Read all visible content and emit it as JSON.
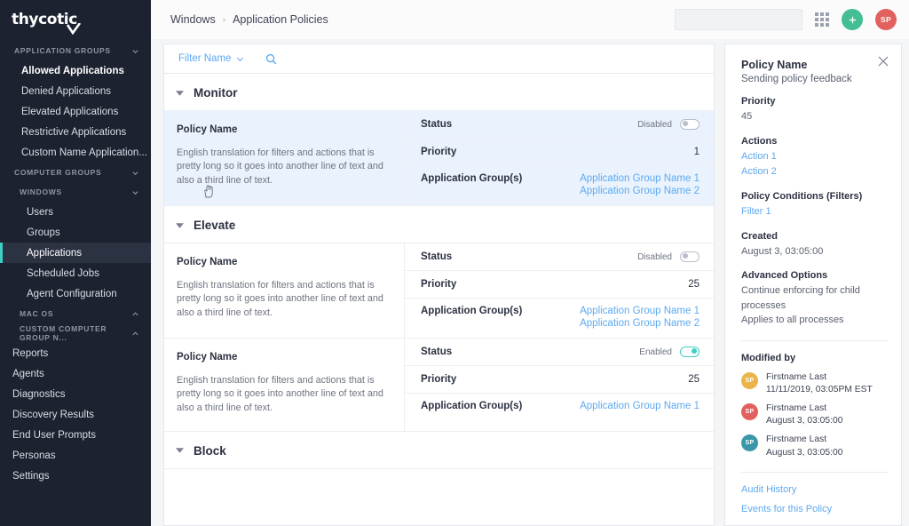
{
  "brand": {
    "logo_text": "thycotic",
    "accent": "#3ecfc4"
  },
  "sidebar": {
    "groups": [
      {
        "label": "APPLICATION GROUPS",
        "icon": "chevron-down-icon",
        "expanded": true
      },
      {
        "label": "COMPUTER GROUPS",
        "icon": "chevron-down-icon",
        "expanded": true
      },
      {
        "label": "WINDOWS",
        "icon": "chevron-down-icon",
        "expanded": true
      },
      {
        "label": "MAC OS",
        "icon": "chevron-up-icon",
        "expanded": false
      },
      {
        "label": "CUSTOM COMPUTER GROUP N...",
        "icon": "chevron-up-icon",
        "expanded": false
      }
    ],
    "app_group_items": [
      {
        "label": "Allowed Applications"
      },
      {
        "label": "Denied Applications"
      },
      {
        "label": "Elevated Applications"
      },
      {
        "label": "Restrictive Applications"
      },
      {
        "label": "Custom Name Application..."
      }
    ],
    "windows_items": [
      {
        "label": "Users",
        "active": false
      },
      {
        "label": "Groups",
        "active": false
      },
      {
        "label": "Applications",
        "active": true
      },
      {
        "label": "Scheduled Jobs",
        "active": false
      },
      {
        "label": "Agent Configuration",
        "active": false
      }
    ],
    "bottom_items": [
      {
        "label": "Reports"
      },
      {
        "label": "Agents"
      },
      {
        "label": "Diagnostics"
      },
      {
        "label": "Discovery Results"
      },
      {
        "label": "End User Prompts"
      },
      {
        "label": "Personas"
      },
      {
        "label": "Settings"
      }
    ]
  },
  "topbar": {
    "breadcrumb": [
      "Windows",
      "Application Policies"
    ],
    "separator": "›",
    "search_value": "",
    "search_placeholder": "",
    "search_icon": "search-icon",
    "grid_icon": "grid-apps-icon",
    "add_label": "+",
    "avatar_initials": "SP",
    "add_color": "#43bf93",
    "avatar_color": "#e2605d"
  },
  "filter_bar": {
    "filter_label": "Filter Name",
    "chevron_icon": "chevron-down-icon",
    "search_icon": "search-icon"
  },
  "sections": [
    {
      "title": "Monitor",
      "caret": "caret-down-icon",
      "policies": [
        {
          "selected": true,
          "name": "Policy Name",
          "description": "English translation for filters and actions that is pretty long so it goes into another line of text and also a third line of text.",
          "status_key": "Status",
          "status_label": "Disabled",
          "status_on": false,
          "priority_key": "Priority",
          "priority_value": "1",
          "groups_key": "Application Group(s)",
          "groups": [
            "Application Group Name 1",
            "Application Group Name 2"
          ]
        }
      ]
    },
    {
      "title": "Elevate",
      "caret": "caret-down-icon",
      "policies": [
        {
          "selected": false,
          "name": "Policy Name",
          "description": "English translation for filters and actions that is pretty long so it goes into another line of text and also a third line of text.",
          "status_key": "Status",
          "status_label": "Disabled",
          "status_on": false,
          "priority_key": "Priority",
          "priority_value": "25",
          "groups_key": "Application Group(s)",
          "groups": [
            "Application Group Name 1",
            "Application Group Name 2"
          ]
        },
        {
          "selected": false,
          "name": "Policy Name",
          "description": "English translation for filters and actions that is pretty long so it goes into another line of text and also a third line of text.",
          "status_key": "Status",
          "status_label": "Enabled",
          "status_on": true,
          "priority_key": "Priority",
          "priority_value": "25",
          "groups_key": "Application Group(s)",
          "groups": [
            "Application Group Name 1"
          ]
        }
      ]
    },
    {
      "title": "Block",
      "caret": "caret-down-icon",
      "policies": []
    }
  ],
  "detail": {
    "close_icon": "close-icon",
    "title": "Policy Name",
    "subtitle": "Sending policy feedback",
    "priority_label": "Priority",
    "priority_value": "45",
    "actions_label": "Actions",
    "actions": [
      "Action 1",
      "Action 2"
    ],
    "conditions_label": "Policy Conditions (Filters)",
    "conditions": [
      "Filter 1"
    ],
    "created_label": "Created",
    "created_value": "August 3, 03:05:00",
    "advanced_label": "Advanced Options",
    "advanced_options": [
      "Continue enforcing for child processes",
      "Applies to all processes"
    ],
    "modified_label": "Modified by",
    "modified_by": [
      {
        "initials": "SP",
        "color": "#eab44a",
        "name": "Firstname Last",
        "date": "11/11/2019, 03:05PM EST"
      },
      {
        "initials": "SP",
        "color": "#e2605d",
        "name": "Firstname Last",
        "date": "August 3, 03:05:00"
      },
      {
        "initials": "SP",
        "color": "#3b97a8",
        "name": "Firstname Last",
        "date": "August 3, 03:05:00"
      }
    ],
    "footer_links": [
      "Audit History",
      "Events for this Policy"
    ]
  }
}
